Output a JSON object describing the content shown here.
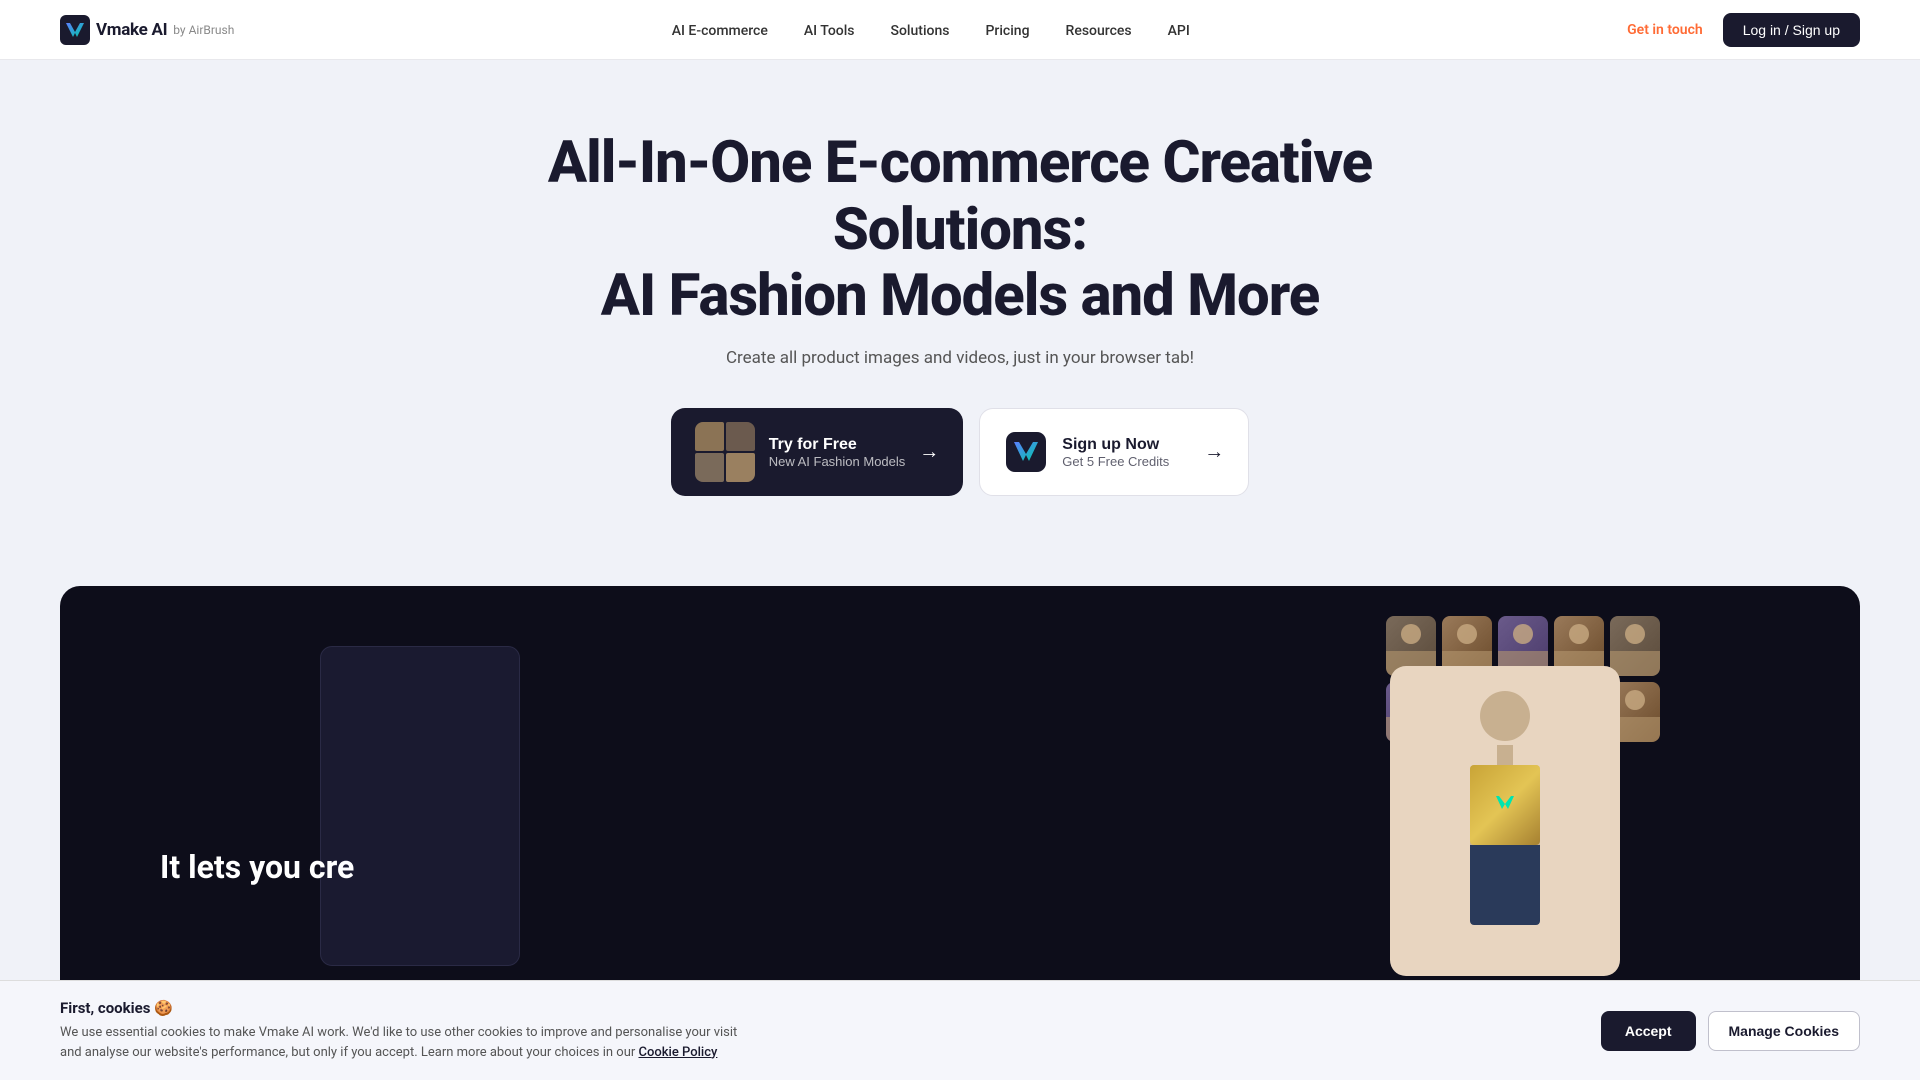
{
  "brand": {
    "name": "Vmake AI",
    "by": "by AirBrush",
    "logo_alt": "Vmake AI Logo"
  },
  "nav": {
    "items": [
      {
        "label": "AI E-commerce",
        "href": "#"
      },
      {
        "label": "AI Tools",
        "href": "#"
      },
      {
        "label": "Solutions",
        "href": "#"
      },
      {
        "label": "Pricing",
        "href": "#"
      },
      {
        "label": "Resources",
        "href": "#"
      },
      {
        "label": "API",
        "href": "#"
      }
    ],
    "get_in_touch": "Get in touch",
    "login_signup": "Log in / Sign up"
  },
  "hero": {
    "title_line1": "All-In-One E-commerce Creative Solutions:",
    "title_line2": "AI Fashion Models and More",
    "subtitle": "Create all product images and videos, just in your browser tab!"
  },
  "cta": {
    "primary": {
      "title": "Try for Free",
      "subtitle": "New AI Fashion Models",
      "arrow": "→"
    },
    "secondary": {
      "title": "Sign up Now",
      "subtitle": "Get 5 Free Credits",
      "arrow": "→"
    }
  },
  "demo": {
    "text": "It lets you cre"
  },
  "cookie": {
    "title": "First, cookies 🍪",
    "description": "We use essential cookies to make Vmake AI work. We'd like to use other cookies to improve and personalise your visit and analyse our website's performance, but only if you accept. Learn more about your choices in our",
    "link_text": "Cookie Policy",
    "accept_label": "Accept",
    "manage_label": "Manage Cookies"
  },
  "colors": {
    "dark": "#1a1a2e",
    "accent": "#ff6b35",
    "white": "#ffffff",
    "light_bg": "#f0f2f8"
  }
}
